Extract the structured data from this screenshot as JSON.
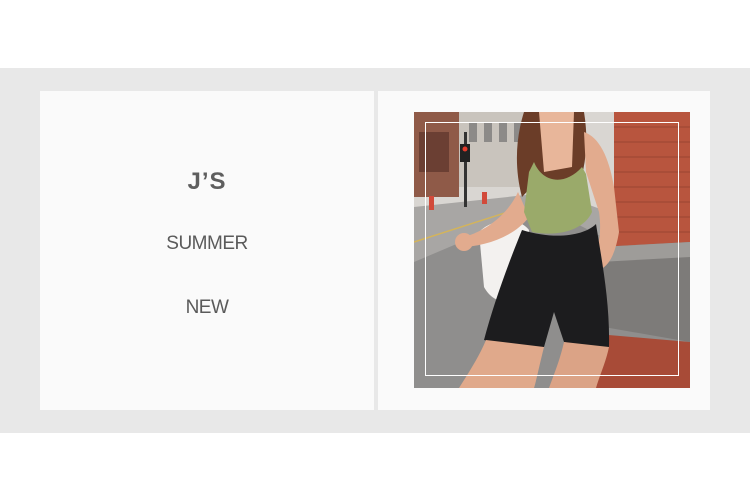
{
  "banner": {
    "brand": "J’S",
    "line1": "SUMMER",
    "line2": "NEW"
  },
  "photo": {
    "subject": "fashion-model-photo"
  },
  "colors": {
    "band": "#e8e8e8",
    "card": "#fafafa",
    "text": "#5a5a5a",
    "top": "#9aaa6a",
    "shorts": "#1c1c1e",
    "brick": "#b8553e"
  }
}
